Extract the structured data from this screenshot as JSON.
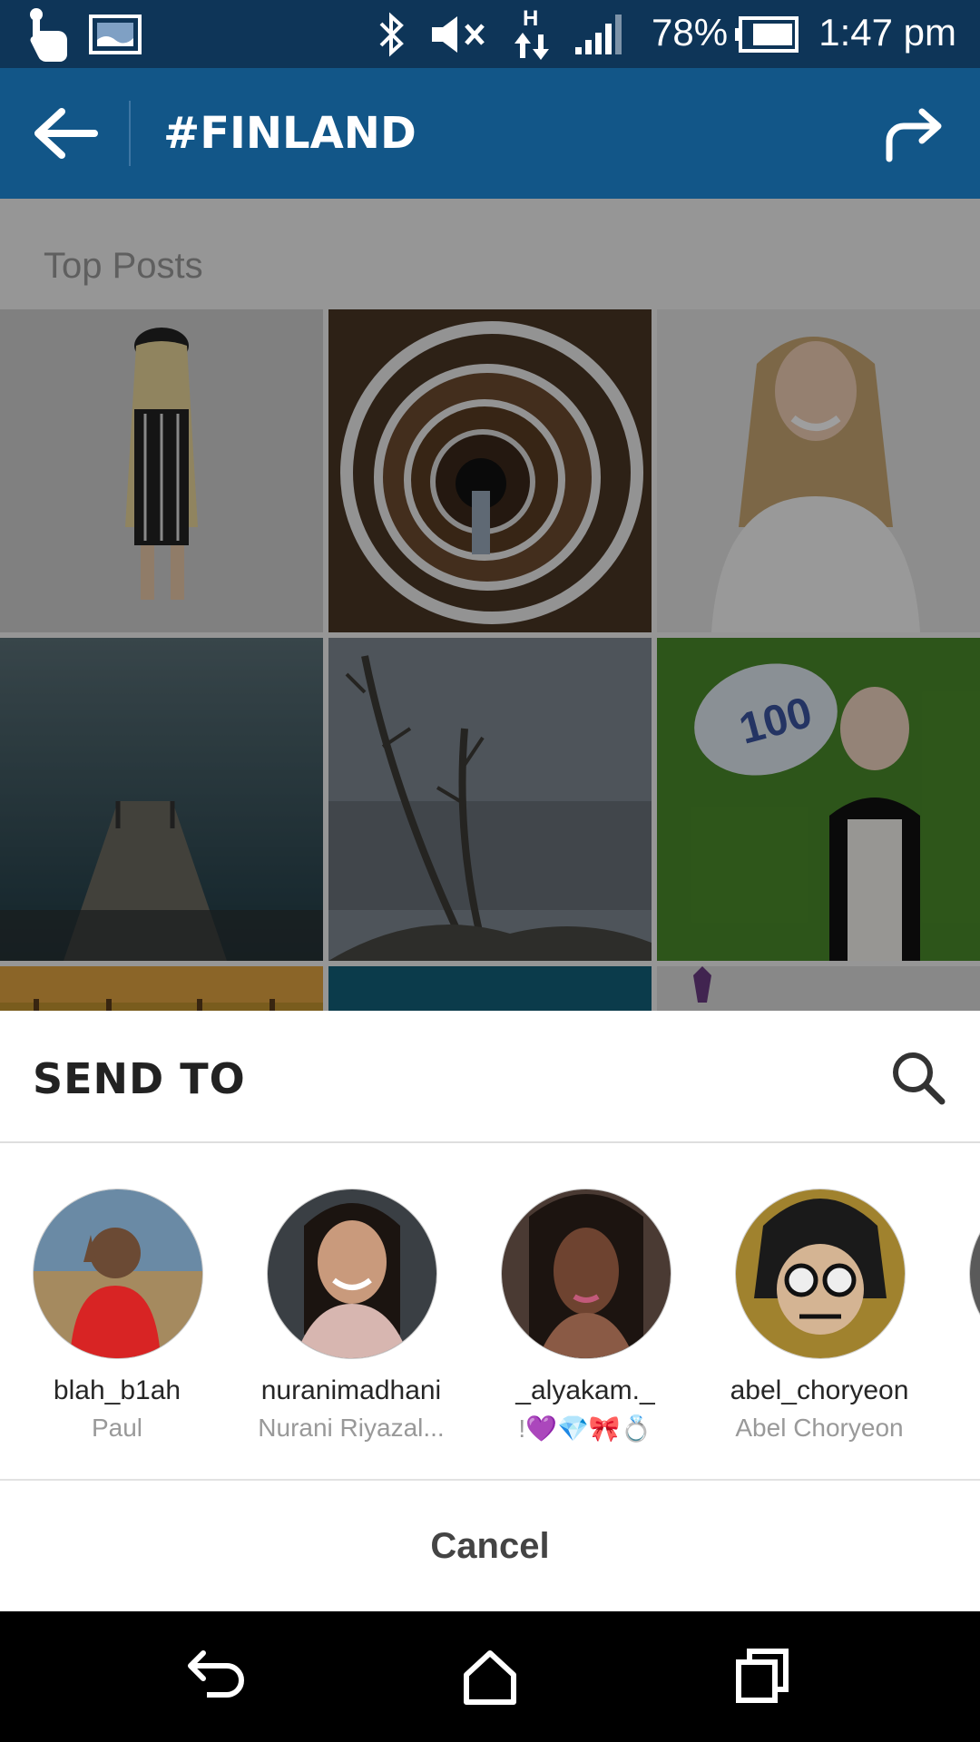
{
  "status_bar": {
    "battery_percent": "78%",
    "time": "1:47 pm",
    "network_type": "H",
    "icons": [
      "touch-icon",
      "image-icon",
      "bluetooth-icon",
      "mute-icon",
      "data-icon",
      "signal-icon",
      "battery-icon"
    ]
  },
  "app_bar": {
    "title": "#FINLAND",
    "back_icon": "arrow-left-icon",
    "share_icon": "share-arrow-icon"
  },
  "content": {
    "section_title": "Top Posts",
    "posts": [
      {
        "subject": "woman-in-striped-romper",
        "bg": "#cfcfcf"
      },
      {
        "subject": "spiral-staircase",
        "bg": "#3a2b20"
      },
      {
        "subject": "smiling-blonde-woman",
        "bg": "#e6e6e6"
      },
      {
        "subject": "misty-pier",
        "bg": "#2c4b55"
      },
      {
        "subject": "bare-trees-fog",
        "bg": "#7e8791"
      },
      {
        "subject": "woman-holding-sign-100",
        "bg": "#4d8a2c"
      },
      {
        "subject": "autumn-trees",
        "bg": "#c79a3a"
      },
      {
        "subject": "blue-water",
        "bg": "#12607a"
      },
      {
        "subject": "purple-figure",
        "bg": "#d8d8d8"
      }
    ],
    "sign_text": "100"
  },
  "share_sheet": {
    "title": "SEND TO",
    "search_icon": "search-icon",
    "recipients": [
      {
        "username": "blah_b1ah",
        "full_name": "Paul"
      },
      {
        "username": "nuranimadhani",
        "full_name": "Nurani Riyazal..."
      },
      {
        "username": "_alyakam._",
        "full_name": "!💜💎🎀💍"
      },
      {
        "username": "abel_choryeon",
        "full_name": "Abel Choryeon"
      }
    ],
    "cancel_label": "Cancel"
  },
  "nav_bar": {
    "icons": [
      "back-nav-icon",
      "home-nav-icon",
      "recents-nav-icon"
    ]
  },
  "colors": {
    "status_bar": "#0e3558",
    "app_bar": "#125688",
    "sheet_bg": "#ffffff"
  }
}
